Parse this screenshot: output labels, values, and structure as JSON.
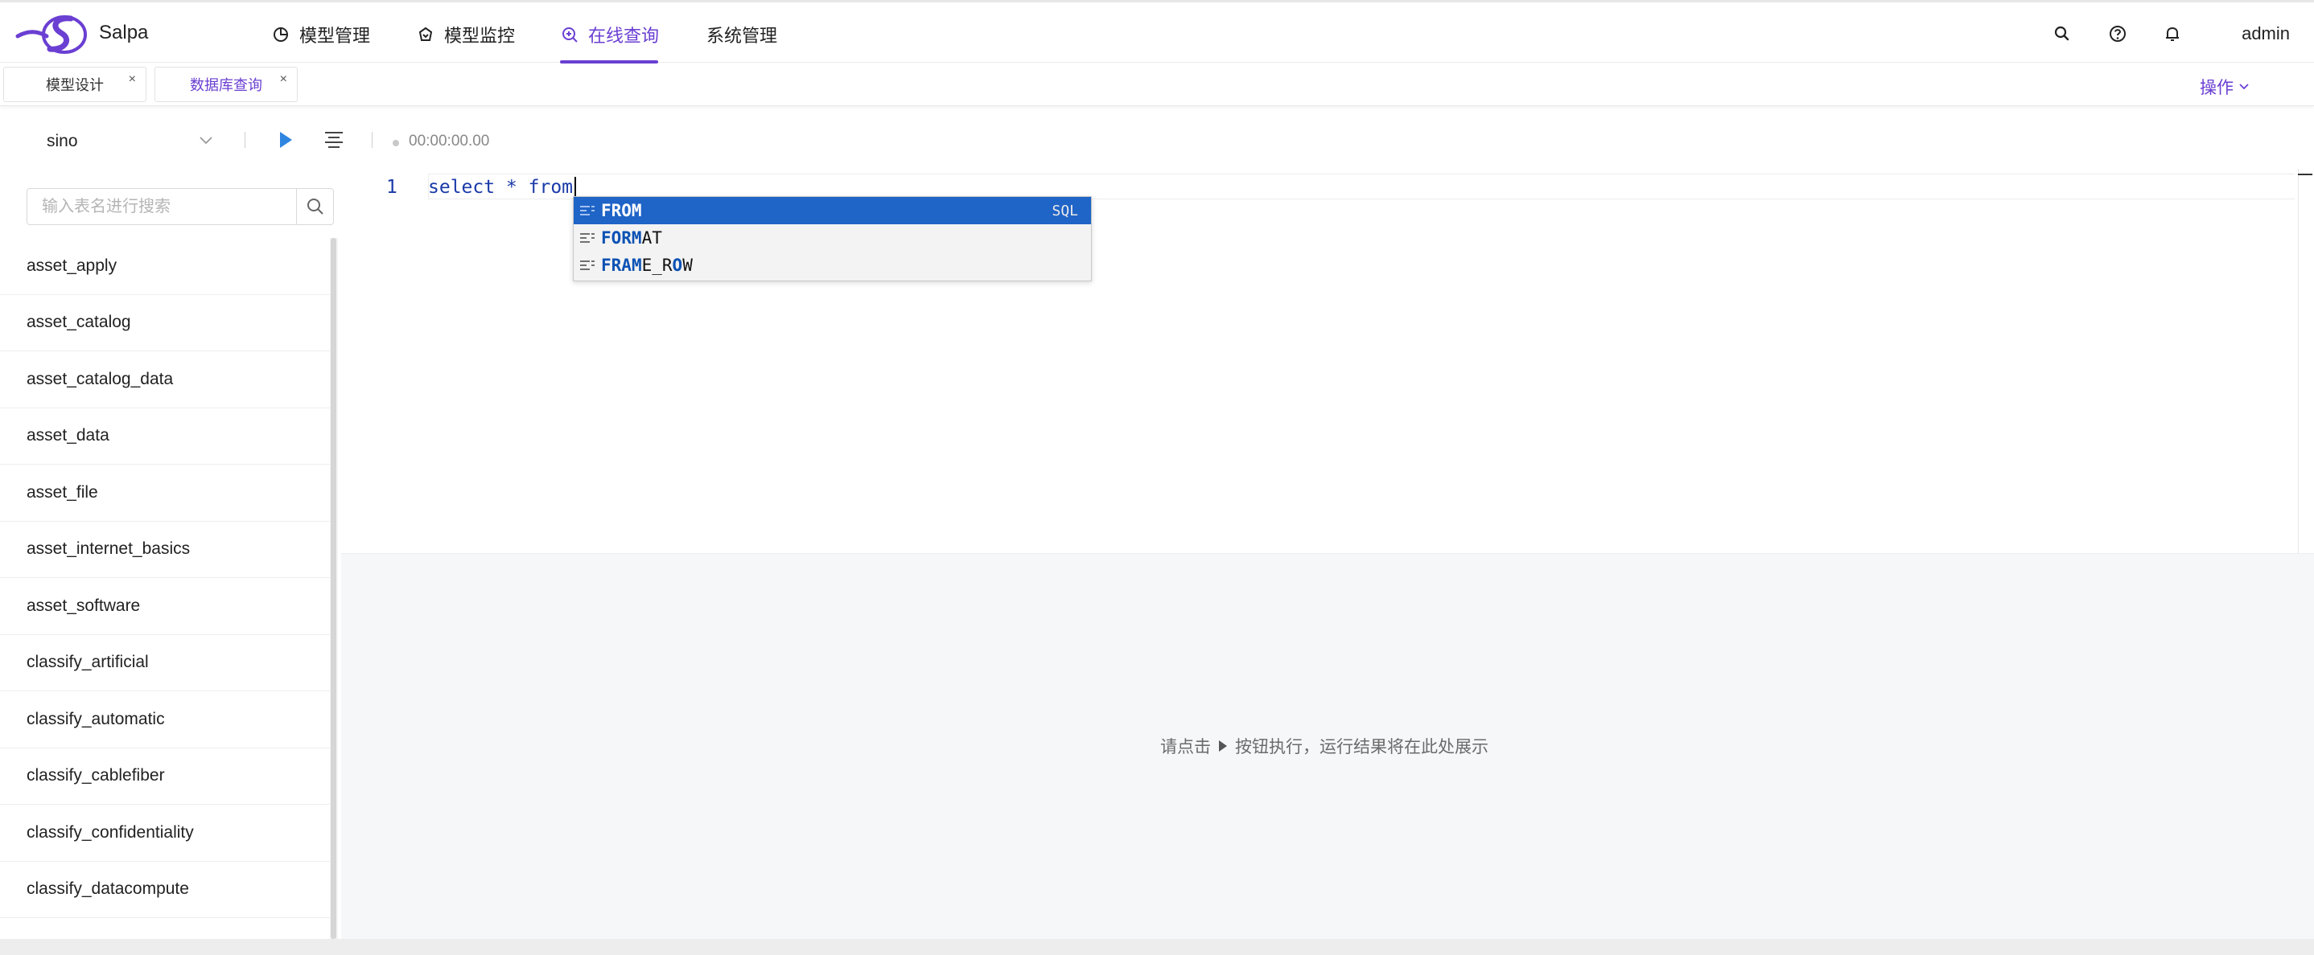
{
  "app": {
    "brand": "Salpa",
    "user": "admin",
    "accent_color": "#6a3fd2"
  },
  "nav": {
    "items": [
      {
        "label": "模型管理",
        "icon": "pie-chart-icon"
      },
      {
        "label": "模型监控",
        "icon": "monitor-gem-icon"
      },
      {
        "label": "在线查询",
        "icon": "search-plus-icon",
        "active": true
      },
      {
        "label": "系统管理",
        "icon": ""
      }
    ]
  },
  "header_icons": [
    "search-icon",
    "help-icon",
    "bell-icon"
  ],
  "tabs": {
    "items": [
      {
        "label": "模型设计",
        "close": "×"
      },
      {
        "label": "数据库查询",
        "close": "×",
        "active": true
      }
    ],
    "ops_label": "操作"
  },
  "toolbar": {
    "database": "sino",
    "timer": "00:00:00.00"
  },
  "sidebar": {
    "search_placeholder": "输入表名进行搜索",
    "tables": [
      "asset_apply",
      "asset_catalog",
      "asset_catalog_data",
      "asset_data",
      "asset_file",
      "asset_internet_basics",
      "asset_software",
      "classify_artificial",
      "classify_automatic",
      "classify_cablefiber",
      "classify_confidentiality",
      "classify_datacompute"
    ]
  },
  "editor": {
    "line_number": "1",
    "code": "select * from"
  },
  "autocomplete": {
    "items": [
      {
        "match": "FROM",
        "rest": "",
        "source": "SQL",
        "selected": true
      },
      {
        "match": "FORM",
        "rest": "AT",
        "source": ""
      },
      {
        "match_parts": [
          "FR",
          "A",
          "M",
          "E_R",
          "O",
          "W"
        ],
        "text": "FRAME_ROW"
      }
    ],
    "item3_prefix": "FR",
    "item3_a": "A",
    "item3_m": "M",
    "item3_er": "E_R",
    "item3_o": "O",
    "item3_w": "W"
  },
  "results": {
    "msg_before": "请点击",
    "msg_after": "按钮执行，运行结果将在此处展示"
  }
}
